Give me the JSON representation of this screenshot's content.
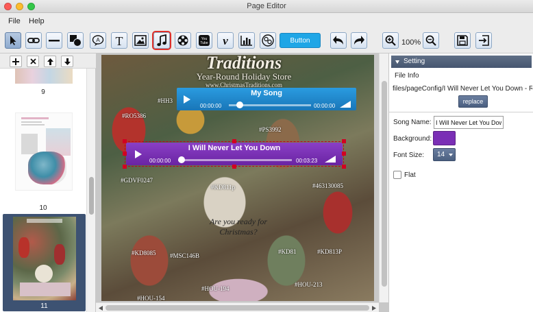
{
  "window": {
    "title": "Page Editor"
  },
  "menu": {
    "file": "File",
    "help": "Help"
  },
  "toolbar": {
    "button_label": "Button",
    "zoom": "100%"
  },
  "pages": [
    {
      "number": "9"
    },
    {
      "number": "10"
    },
    {
      "number": "11"
    }
  ],
  "canvas": {
    "header_title": "Traditions",
    "header_subtitle": "Year-Round Holiday Store",
    "header_url": "www.ChristmasTraditions.com",
    "tagline_1": "Are you ready for",
    "tagline_2": "Christmas?",
    "labels": [
      "#HH3",
      "#RO5386",
      "#PS3992",
      "#GDVF0247",
      "#KD811p",
      "#463130085",
      "#KD8085",
      "#MSC146B",
      "#KD81",
      "#KD813P",
      "#HOU-194",
      "#HOU-154",
      "#HOU-213"
    ]
  },
  "players": {
    "song1": {
      "title": "My Song",
      "start": "00:00:00",
      "end": "00:00:00",
      "progress": 0.1,
      "color": "#1e8cd1"
    },
    "song2": {
      "title": "I Will Never Let You Down",
      "start": "00:00:00",
      "end": "00:03:23",
      "progress": 0.2,
      "color": "#7a2fb5"
    }
  },
  "setting": {
    "header": "Setting",
    "file_info_label": "File Info",
    "file_path": "files/pageConfig/I Will Never Let You Down - Rita O",
    "replace_label": "replace",
    "song_name_label": "Song Name:",
    "song_name_value": "I Will Never Let You Down",
    "background_label": "Background:",
    "background_color": "#7a2fb5",
    "font_size_label": "Font Size:",
    "font_size_value": "14",
    "flat_label": "Flat"
  }
}
